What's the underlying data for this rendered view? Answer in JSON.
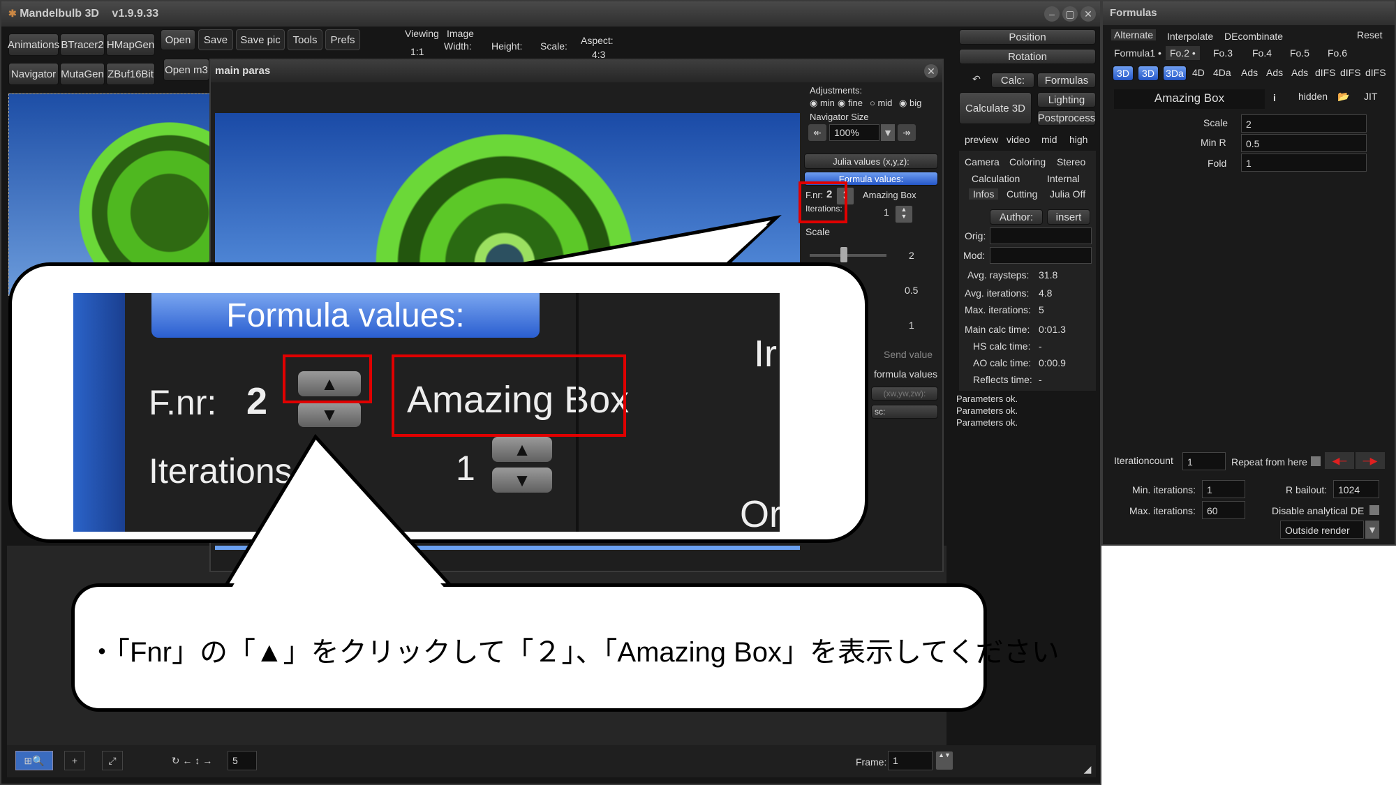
{
  "main_window": {
    "app_title": "Mandelbulb 3D",
    "version": "v1.9.9.33",
    "toolbar_row1": [
      "Animations",
      "BTracer2",
      "HMapGen"
    ],
    "toolbar_row2": [
      "Navigator",
      "MutaGen",
      "ZBuf16Bit"
    ],
    "menu": [
      "Open",
      "Save",
      "Save pic",
      "Tools",
      "Prefs"
    ],
    "open_m3": "Open m3",
    "viewing_label": "Viewing",
    "viewing_value": "1:1",
    "image_label": "Image",
    "width_label": "Width:",
    "height_label": "Height:",
    "scale_label": "Scale:",
    "aspect_label": "Aspect:",
    "aspect_value": "4:3"
  },
  "right_panel": {
    "position": "Position",
    "rotation": "Rotation",
    "calc": "Calc:",
    "formulas": "Formulas",
    "calculate_3d": "Calculate 3D",
    "lighting": "Lighting",
    "postprocess": "Postprocess",
    "quality": [
      "preview",
      "video",
      "mid",
      "high"
    ],
    "tabs_row1": [
      "Camera",
      "Coloring",
      "Stereo"
    ],
    "tabs_row2": [
      "Calculation",
      "Internal"
    ],
    "tabs_row3": [
      "Infos",
      "Cutting",
      "Julia Off"
    ],
    "author": "Author:",
    "insert": "insert",
    "orig_label": "Orig:",
    "mod_label": "Mod:",
    "stats": [
      {
        "label": "Avg. raysteps:",
        "value": "31.8"
      },
      {
        "label": "Avg. iterations:",
        "value": "4.8"
      },
      {
        "label": "Max. iterations:",
        "value": "5"
      },
      {
        "label": "Main calc time:",
        "value": "0:01.3"
      },
      {
        "label": "HS calc time:",
        "value": "-"
      },
      {
        "label": "AO calc time:",
        "value": "0:00.9"
      },
      {
        "label": "Reflects time:",
        "value": "-"
      }
    ],
    "log": [
      "Parameters ok.",
      "Parameters ok.",
      "Parameters ok."
    ]
  },
  "main_paras": {
    "title": "main paras",
    "adjustments": "Adjustments:",
    "adj_options": [
      "min",
      "fine",
      "mid",
      "big"
    ],
    "navigator_size": "Navigator Size",
    "nav_size_value": "100%",
    "julia_values": "Julia values (x,y,z):",
    "formula_values": "Formula values:",
    "fnr_label": "F.nr:",
    "fnr_value": "2",
    "formula_name": "Amazing Box",
    "iterations_label": "Iterations:",
    "iterations_value": "1",
    "scale_label": "Scale",
    "scale_value": "2",
    "val2": "0.5",
    "val3": "1",
    "send_value": "Send value",
    "formula_values_small": "formula values",
    "xwywzw": "(xw,yw,zw):",
    "sc": "sc:"
  },
  "status_bar": {
    "step_value": "5",
    "frame_label": "Frame:",
    "frame_value": "1"
  },
  "formulas_window": {
    "title": "Formulas",
    "tabs": [
      "Alternate",
      "Interpolate",
      "DEcombinate"
    ],
    "reset": "Reset",
    "formula_tabs": [
      "Formula1 •",
      "Fo.2 •",
      "Fo.3",
      "Fo.4",
      "Fo.5",
      "Fo.6"
    ],
    "mode_buttons": [
      "3D",
      "3D",
      "3Da",
      "4D",
      "4Da",
      "Ads",
      "Ads",
      "Ads",
      "dIFS",
      "dIFS",
      "dIFS"
    ],
    "formula_name": "Amazing Box",
    "info_icon": "i",
    "hidden": "hidden",
    "jit": "JIT",
    "params": [
      {
        "label": "Scale",
        "value": "2"
      },
      {
        "label": "Min R",
        "value": "0.5"
      },
      {
        "label": "Fold",
        "value": "1"
      }
    ],
    "iterationcount_label": "Iterationcount",
    "iterationcount_value": "1",
    "repeat_from_here": "Repeat from here",
    "min_iter_label": "Min. iterations:",
    "min_iter_value": "1",
    "max_iter_label": "Max. iterations:",
    "max_iter_value": "60",
    "r_bailout_label": "R bailout:",
    "r_bailout_value": "1024",
    "disable_de": "Disable analytical DE",
    "outside_render": "Outside render"
  },
  "zoom_callout": {
    "formula_values": "Formula values:",
    "fnr_label": "F.nr:",
    "fnr_value": "2",
    "formula_name": "Amazing Box",
    "iterations_label": "Iterations",
    "iterations_value": "1",
    "cut_text1": "Ir",
    "cut_text2": "Or"
  },
  "instruction": {
    "text": "・「Fnr」の「▲」をクリックして「２」、「Amazing Box」を表示してください"
  }
}
